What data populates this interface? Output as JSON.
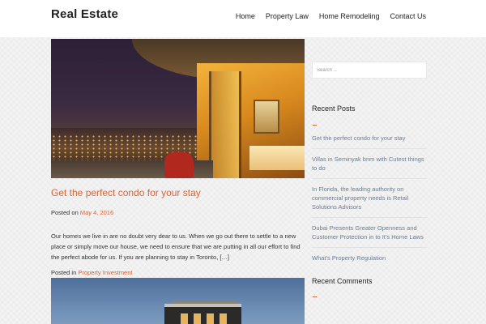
{
  "site": {
    "title": "Real Estate"
  },
  "nav": {
    "items": [
      {
        "label": "Home"
      },
      {
        "label": "Property Law"
      },
      {
        "label": "Home Remodeling"
      },
      {
        "label": "Contact Us"
      }
    ]
  },
  "post": {
    "title": "Get the perfect condo for your stay",
    "posted_on_label": "Posted on",
    "date": "May 4, 2016",
    "excerpt": "Our homes we live in are no doubt very dear to us. When we go out there to settle to a new place or simply move our house, we need to ensure that we are putting in all our effort to find the perfect abode for us. If you are planning to stay in Toronto, […]",
    "posted_in_label": "Posted in",
    "category": "Property Investment"
  },
  "sidebar": {
    "search_placeholder": "Search ...",
    "recent_posts_title": "Recent Posts",
    "recent_posts": [
      {
        "label": "Get the perfect condo for your stay"
      },
      {
        "label": "Villas in Seminyak brim with Cutest things to do"
      },
      {
        "label": "In Florida, the leading authority on commercial property needs is Retail Solutions Advisors"
      },
      {
        "label": "Dubai Presents Greater Openness and Customer Protection in to It’s Home Laws"
      },
      {
        "label": "What’s Property Regulation"
      }
    ],
    "recent_comments_title": "Recent Comments"
  },
  "colors": {
    "accent": "#d5663a",
    "link_muted": "#6b7c90",
    "header_bg": "#ffffff"
  }
}
